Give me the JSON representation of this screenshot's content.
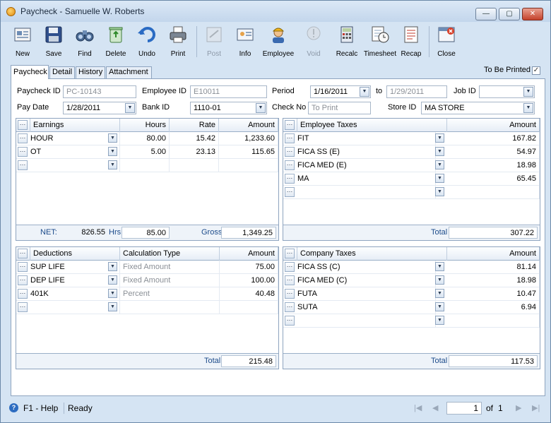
{
  "window": {
    "title": "Paycheck - Samuelle W. Roberts",
    "minimize": "—",
    "maximize": "▢",
    "close": "✕"
  },
  "toolbar": {
    "new": "New",
    "save": "Save",
    "find": "Find",
    "delete": "Delete",
    "undo": "Undo",
    "print": "Print",
    "post": "Post",
    "info": "Info",
    "employee": "Employee",
    "void": "Void",
    "recalc": "Recalc",
    "timesheet": "Timesheet",
    "recap": "Recap",
    "close": "Close"
  },
  "tabs": [
    "Paycheck",
    "Detail",
    "History",
    "Attachment"
  ],
  "to_be_printed": {
    "label": "To Be Printed",
    "checked": "✓"
  },
  "form": {
    "paycheck_id_label": "Paycheck ID",
    "paycheck_id": "PC-10143",
    "employee_id_label": "Employee ID",
    "employee_id": "E10011",
    "period_label": "Period",
    "period_from": "1/16/2011",
    "period_to_label": "to",
    "period_to": "1/29/2011",
    "job_id_label": "Job ID",
    "job_id": "",
    "pay_date_label": "Pay Date",
    "pay_date": "1/28/2011",
    "bank_id_label": "Bank ID",
    "bank_id": "1110-01",
    "check_no_label": "Check No",
    "check_no_placeholder": "To Print",
    "store_id_label": "Store ID",
    "store_id": "MA STORE"
  },
  "earnings": {
    "ellipsis": "…",
    "headers": [
      "Earnings",
      "Hours",
      "Rate",
      "Amount"
    ],
    "rows": [
      {
        "code": "HOUR",
        "hours": "80.00",
        "rate": "15.42",
        "amount": "1,233.60"
      },
      {
        "code": "OT",
        "hours": "5.00",
        "rate": "23.13",
        "amount": "115.65"
      },
      {
        "code": "",
        "hours": "",
        "rate": "",
        "amount": ""
      }
    ],
    "footer": {
      "net_label": "NET:",
      "net": "826.55",
      "hrs_label": "Hrs",
      "hrs": "85.00",
      "gross_label": "Gross",
      "gross": "1,349.25"
    }
  },
  "employee_taxes": {
    "ellipsis": "…",
    "headers": [
      "Employee Taxes",
      "Amount"
    ],
    "rows": [
      {
        "code": "FIT",
        "amount": "167.82"
      },
      {
        "code": "FICA SS (E)",
        "amount": "54.97"
      },
      {
        "code": "FICA MED (E)",
        "amount": "18.98"
      },
      {
        "code": "MA",
        "amount": "65.45"
      },
      {
        "code": "",
        "amount": ""
      }
    ],
    "footer": {
      "total_label": "Total",
      "total": "307.22"
    }
  },
  "deductions": {
    "ellipsis": "…",
    "headers": [
      "Deductions",
      "Calculation Type",
      "Amount"
    ],
    "rows": [
      {
        "code": "SUP LIFE",
        "calc": "Fixed Amount",
        "amount": "75.00"
      },
      {
        "code": "DEP LIFE",
        "calc": "Fixed Amount",
        "amount": "100.00"
      },
      {
        "code": "401K",
        "calc": "Percent",
        "amount": "40.48"
      },
      {
        "code": "",
        "calc": "",
        "amount": ""
      }
    ],
    "footer": {
      "total_label": "Total",
      "total": "215.48"
    }
  },
  "company_taxes": {
    "ellipsis": "…",
    "headers": [
      "Company Taxes",
      "Amount"
    ],
    "rows": [
      {
        "code": "FICA SS (C)",
        "amount": "81.14"
      },
      {
        "code": "FICA MED (C)",
        "amount": "18.98"
      },
      {
        "code": "FUTA",
        "amount": "10.47"
      },
      {
        "code": "SUTA",
        "amount": "6.94"
      },
      {
        "code": "",
        "amount": ""
      }
    ],
    "footer": {
      "total_label": "Total",
      "total": "117.53"
    }
  },
  "status": {
    "help_icon": "?",
    "help": "F1 - Help",
    "state": "Ready",
    "page": "1",
    "of_label": "of",
    "pages": "1",
    "first": "|◀",
    "prev": "◀",
    "next": "▶",
    "last": "▶|"
  },
  "colors": {
    "accent": "#2d6cc0",
    "frame": "#d5e4f3",
    "border": "#8ea4bf"
  }
}
